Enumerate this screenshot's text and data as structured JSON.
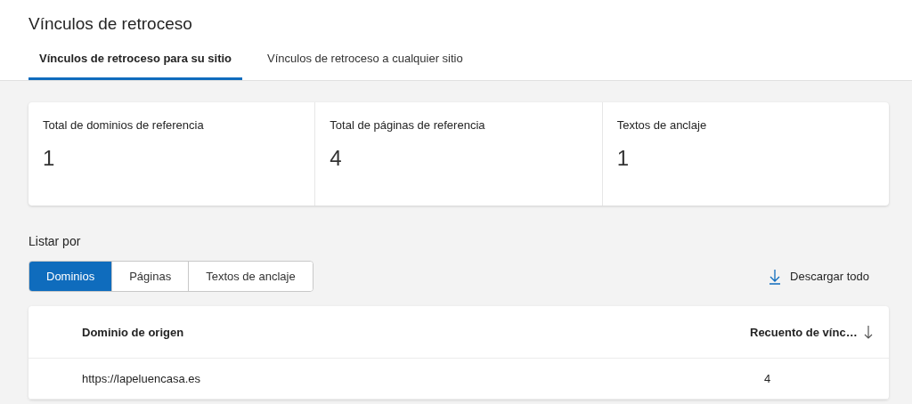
{
  "page_title": "Vínculos de retroceso",
  "tabs": [
    {
      "label": "Vínculos de retroceso para su sitio",
      "selected": true
    },
    {
      "label": "Vínculos de retroceso a cualquier sitio",
      "selected": false
    }
  ],
  "stats": [
    {
      "label": "Total de dominios de referencia",
      "value": "1"
    },
    {
      "label": "Total de páginas de referencia",
      "value": "4"
    },
    {
      "label": "Textos de anclaje",
      "value": "1"
    }
  ],
  "list_by": {
    "label": "Listar por",
    "options": [
      {
        "label": "Dominios",
        "selected": true
      },
      {
        "label": "Páginas",
        "selected": false
      },
      {
        "label": "Textos de anclaje",
        "selected": false
      }
    ]
  },
  "download_button": "Descargar todo",
  "table": {
    "columns": [
      "Dominio de origen",
      "Recuento de vínc…"
    ],
    "rows": [
      [
        "https://lapeluencasa.es",
        "4"
      ]
    ]
  }
}
